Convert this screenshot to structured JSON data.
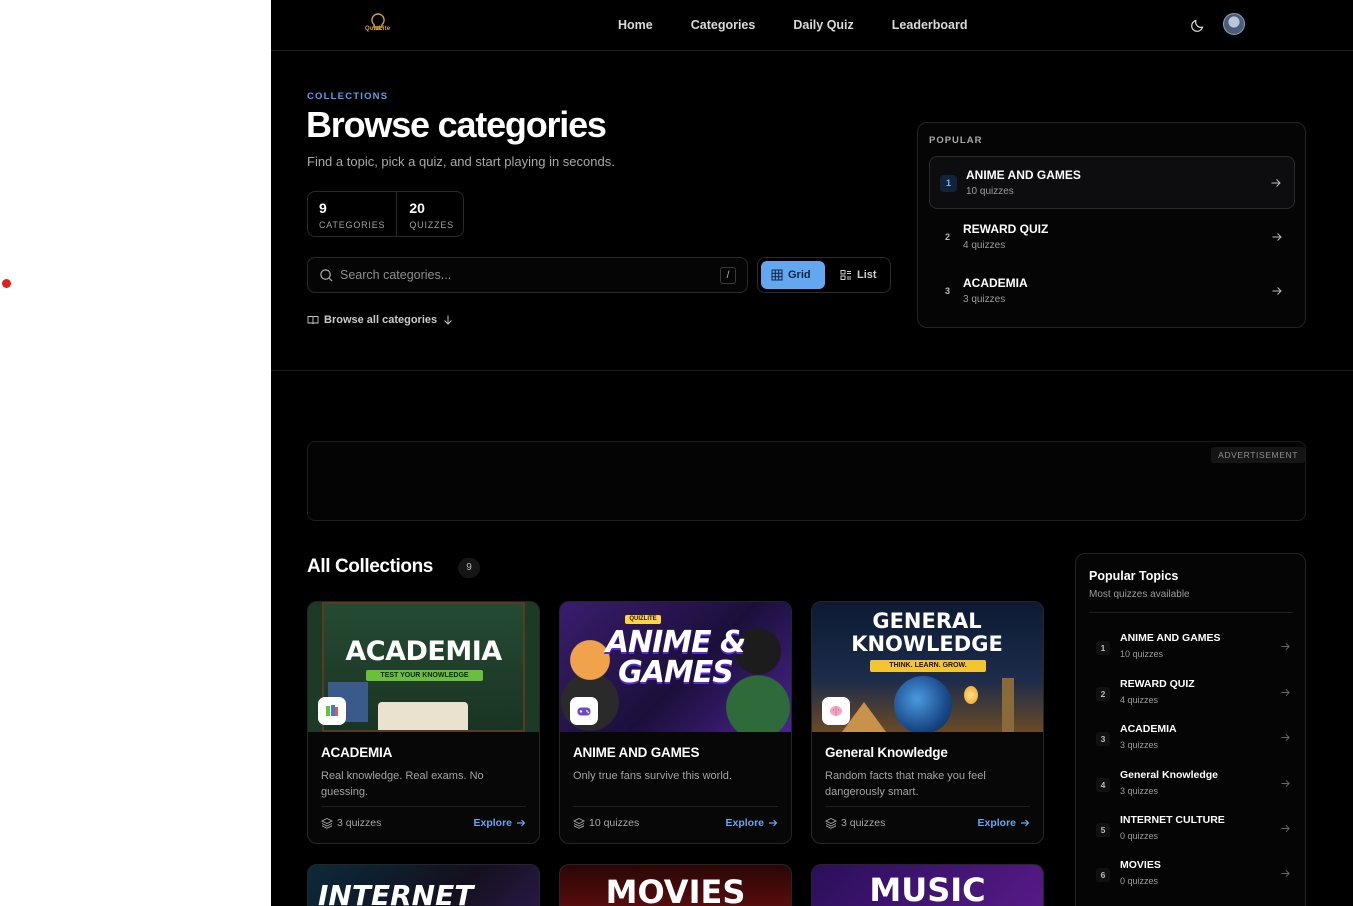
{
  "header": {
    "logo_text": "QuizLite",
    "nav": [
      "Home",
      "Categories",
      "Daily Quiz",
      "Leaderboard"
    ]
  },
  "hero": {
    "eyebrow": "COLLECTIONS",
    "title": "Browse categories",
    "subtitle": "Find a topic, pick a quiz, and start playing in seconds.",
    "stats": [
      {
        "value": "9",
        "label": "CATEGORIES"
      },
      {
        "value": "20",
        "label": "QUIZZES"
      }
    ],
    "search_placeholder": "Search categories...",
    "search_shortcut": "/",
    "view_grid": "Grid",
    "view_list": "List",
    "browse_all": "Browse all categories"
  },
  "popular": {
    "title": "POPULAR",
    "items": [
      {
        "rank": "1",
        "name": "ANIME AND GAMES",
        "count": "10 quizzes"
      },
      {
        "rank": "2",
        "name": "REWARD QUIZ",
        "count": "4 quizzes"
      },
      {
        "rank": "3",
        "name": "ACADEMIA",
        "count": "3 quizzes"
      }
    ]
  },
  "ad": {
    "label": "ADVERTISEMENT"
  },
  "collections": {
    "title": "All Collections",
    "count": "9",
    "cards": [
      {
        "name": "ACADEMIA",
        "desc": "Real knowledge. Real exams. No guessing.",
        "count": "3 quizzes",
        "explore": "Explore",
        "thumb_title": "ACADEMIA",
        "thumb_tag": "TEST YOUR KNOWLEDGE"
      },
      {
        "name": "ANIME AND GAMES",
        "desc": "Only true fans survive this world.",
        "count": "10 quizzes",
        "explore": "Explore",
        "thumb_title": "ANIME & GAMES",
        "thumb_tag": "QUIZLITE"
      },
      {
        "name": "General Knowledge",
        "desc": "Random facts that make you feel dangerously smart.",
        "count": "3 quizzes",
        "explore": "Explore",
        "thumb_title": "GENERAL KNOWLEDGE",
        "thumb_tag": "THINK. LEARN. GROW."
      }
    ],
    "more": [
      {
        "thumb_title": "INTERNET"
      },
      {
        "thumb_title": "MOVIES"
      },
      {
        "thumb_title": "MUSIC"
      }
    ]
  },
  "topics": {
    "title": "Popular Topics",
    "subtitle": "Most quizzes available",
    "items": [
      {
        "rank": "1",
        "name": "ANIME AND GAMES",
        "count": "10 quizzes"
      },
      {
        "rank": "2",
        "name": "REWARD QUIZ",
        "count": "4 quizzes"
      },
      {
        "rank": "3",
        "name": "ACADEMIA",
        "count": "3 quizzes"
      },
      {
        "rank": "4",
        "name": "General Knowledge",
        "count": "3 quizzes"
      },
      {
        "rank": "5",
        "name": "INTERNET CULTURE",
        "count": "0 quizzes"
      },
      {
        "rank": "6",
        "name": "MOVIES",
        "count": "0 quizzes"
      }
    ]
  },
  "colors": {
    "accent": "#62a7f0",
    "background": "#000000"
  }
}
